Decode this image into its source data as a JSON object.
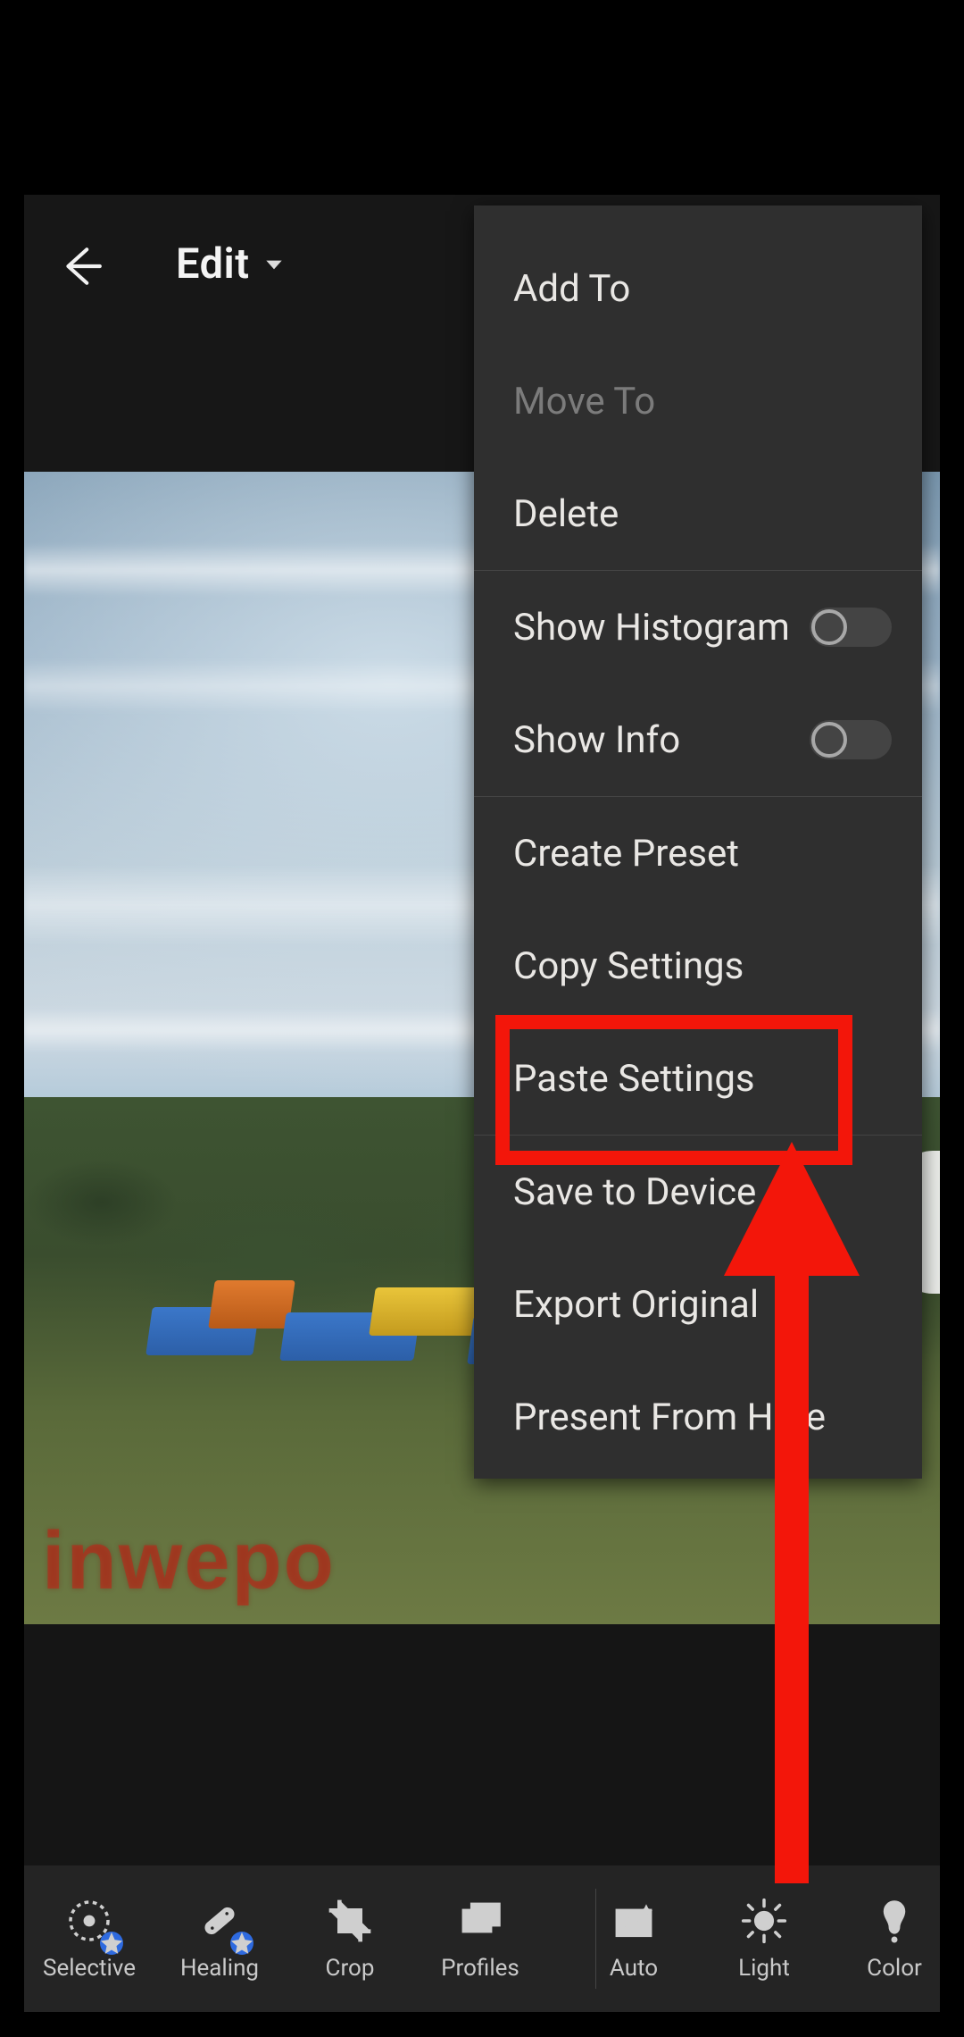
{
  "topbar": {
    "mode_label": "Edit"
  },
  "menu": {
    "items": [
      {
        "id": "add-to",
        "label": "Add To",
        "disabled": false,
        "toggle": null
      },
      {
        "id": "move-to",
        "label": "Move To",
        "disabled": true,
        "toggle": null
      },
      {
        "id": "delete",
        "label": "Delete",
        "disabled": false,
        "toggle": null
      },
      {
        "sep": true
      },
      {
        "id": "show-histogram",
        "label": "Show Histogram",
        "disabled": false,
        "toggle": false
      },
      {
        "id": "show-info",
        "label": "Show Info",
        "disabled": false,
        "toggle": false
      },
      {
        "sep": true
      },
      {
        "id": "create-preset",
        "label": "Create Preset",
        "disabled": false,
        "toggle": null
      },
      {
        "id": "copy-settings",
        "label": "Copy Settings",
        "disabled": false,
        "toggle": null
      },
      {
        "id": "paste-settings",
        "label": "Paste Settings",
        "disabled": false,
        "toggle": null
      },
      {
        "sep": true
      },
      {
        "id": "save-to-device",
        "label": "Save to Device",
        "disabled": false,
        "toggle": null
      },
      {
        "id": "export-original",
        "label": "Export Original",
        "disabled": false,
        "toggle": null
      },
      {
        "id": "present-from-here",
        "label": "Present From Here",
        "disabled": false,
        "toggle": null
      }
    ]
  },
  "toolbar": {
    "tools": [
      {
        "id": "selective",
        "label": "Selective",
        "premium": true
      },
      {
        "id": "healing",
        "label": "Healing",
        "premium": true
      },
      {
        "id": "crop",
        "label": "Crop",
        "premium": false
      },
      {
        "id": "profiles",
        "label": "Profiles",
        "premium": false
      },
      {
        "id": "auto",
        "label": "Auto",
        "premium": false
      },
      {
        "id": "light",
        "label": "Light",
        "premium": false
      },
      {
        "id": "color",
        "label": "Color",
        "premium": false
      }
    ]
  },
  "watermark": "inwepo",
  "annotation": {
    "highlight_item_id": "paste-settings"
  },
  "colors": {
    "annotation_red": "#f3160a",
    "premium_badge_blue": "#2e6adf",
    "menu_bg": "#2f2f2f",
    "toolbar_bg": "#242424"
  }
}
